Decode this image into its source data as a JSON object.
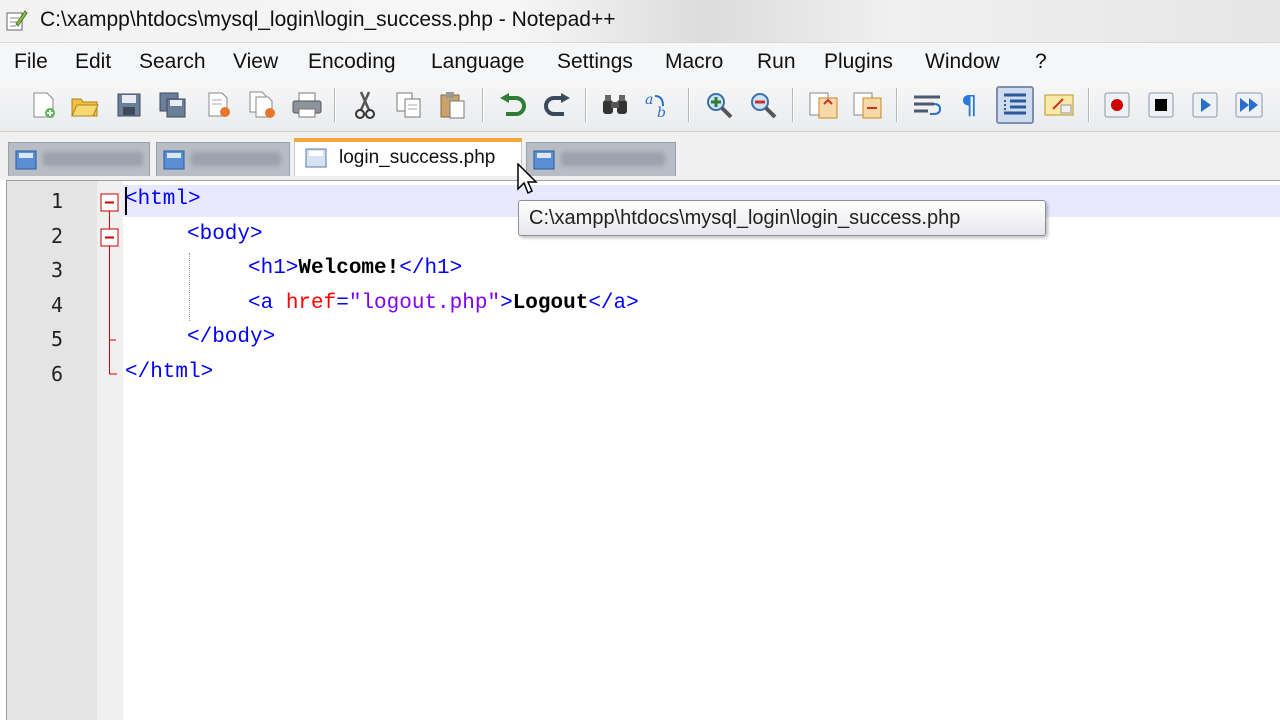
{
  "window": {
    "title": "C:\\xampp\\htdocs\\mysql_login\\login_success.php - Notepad++"
  },
  "menu": [
    "File",
    "Edit",
    "Search",
    "View",
    "Encoding",
    "Language",
    "Settings",
    "Macro",
    "Run",
    "Plugins",
    "Window",
    "?"
  ],
  "toolbar": {
    "icons": [
      "new-file-icon",
      "open-file-icon",
      "save-icon",
      "save-all-icon",
      "close-icon",
      "close-all-icon",
      "print-icon",
      "cut-icon",
      "copy-icon",
      "paste-icon",
      "undo-icon",
      "redo-icon",
      "find-icon",
      "replace-icon",
      "zoom-in-icon",
      "zoom-out-icon",
      "sync-vertical-icon",
      "sync-horizontal-icon",
      "word-wrap-icon",
      "show-all-chars-icon",
      "indent-guide-icon",
      "doc-map-icon",
      "record-macro-icon",
      "stop-record-icon",
      "play-macro-icon",
      "run-macro-multiple-icon"
    ],
    "pressed": "indent-guide-icon"
  },
  "tabs": {
    "active_label": "login_success.php",
    "accent_color": "#f7a53b"
  },
  "editor": {
    "line_numbers": [
      "1",
      "2",
      "3",
      "4",
      "5",
      "6"
    ],
    "lines": {
      "l1": {
        "open": "<html>"
      },
      "l2": {
        "open": "<body>"
      },
      "l3": {
        "open": "<h1>",
        "text": "Welcome!",
        "close": "</h1>"
      },
      "l4": {
        "open": "<a ",
        "attr": "href",
        "eq": "=",
        "value": "\"logout.php\"",
        "gt": ">",
        "text": "Logout",
        "close": "</a>"
      },
      "l5": {
        "close": "</body>"
      },
      "l6": {
        "close": "</html>"
      }
    },
    "colors": {
      "tag": "#0000ff",
      "attribute": "#ff0000",
      "string": "#8000ff",
      "fold_marker": "#cc0000"
    }
  },
  "tooltip": {
    "text": "C:\\xampp\\htdocs\\mysql_login\\login_success.php"
  }
}
